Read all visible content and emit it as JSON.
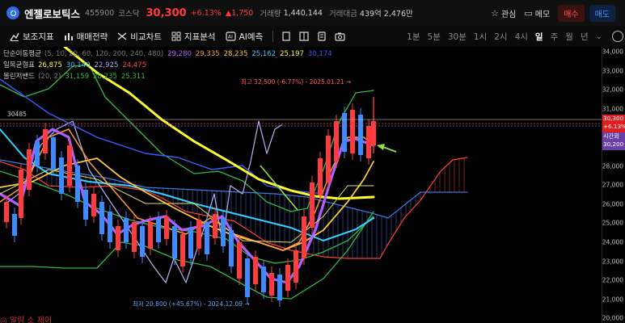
{
  "header": {
    "stock_name": "엔젤로보틱스",
    "stock_code": "455900",
    "market": "코스닥",
    "price": "30,300",
    "change_pct": "+6.13%",
    "change_amt": "▲1,750",
    "volume_label": "거래량",
    "volume": "1,440,144",
    "amount_label": "거래대금",
    "amount": "439억 2,476만",
    "watch_label": "관심",
    "memo_label": "메모",
    "buy_label": "매수",
    "sell_label": "매도"
  },
  "toolbar": {
    "indicators_label": "보조지표",
    "strategy_label": "매매전략",
    "compare_label": "비교차트",
    "drawing_label": "지표분석",
    "ai_label": "AI예측",
    "periods": [
      "1분",
      "5분",
      "30분",
      "1시",
      "2시",
      "4시",
      "일",
      "주",
      "월",
      "년"
    ],
    "active_period": "일"
  },
  "legend": {
    "ma": {
      "name": "단순이동평균",
      "params": "(5, 10, 20, 60, 120, 200, 240, 480)",
      "values": [
        "29,280",
        "29,335",
        "28,235",
        "25,162",
        "25,197",
        "30,174"
      ],
      "colors": [
        "#b060ff",
        "#ff9a3a",
        "#ffc83a",
        "#34d0ff",
        "#ffff2a",
        "#3c5cff"
      ]
    },
    "ichimoku": {
      "name": "일목균형표",
      "values": [
        "26,875",
        "30,140",
        "22,925",
        "24,475"
      ],
      "colors": [
        "#ffff33",
        "#4db8ff",
        "#a9a9ff",
        "#ff4444"
      ]
    },
    "bollinger": {
      "name": "볼린저밴드",
      "params": "(20, 2)",
      "values": [
        "31,159",
        "28,235",
        "25,311"
      ],
      "colors": [
        "#2fb94a",
        "#2fb94a",
        "#2fb94a"
      ]
    }
  },
  "annotations": {
    "high": "최고 32,500 (-6.77%) - 2025.01.21 →",
    "low": "최저 20,800 (+45.67%) - 2024.12.09 →",
    "ref": "30485"
  },
  "axis": {
    "ticks": [
      "34,000",
      "33,000",
      "32,000",
      "31,000",
      "29,000",
      "28,000",
      "27,000",
      "26,000",
      "25,000",
      "24,000",
      "23,000",
      "22,000",
      "21,000",
      "20,000"
    ],
    "tick_values": [
      34000,
      33000,
      32000,
      31000,
      29000,
      28000,
      27000,
      26000,
      25000,
      24000,
      23000,
      22000,
      21000,
      20000
    ],
    "current_price": "30,300",
    "current_pct": "+6.13%",
    "time_label": "시간외",
    "time_price": "30,200"
  },
  "bottom_label": "◎ 알림 소 제어",
  "colors": {
    "up": "#ff3b3b",
    "down": "#3c8cff",
    "accent": "#2f6fe8"
  }
}
